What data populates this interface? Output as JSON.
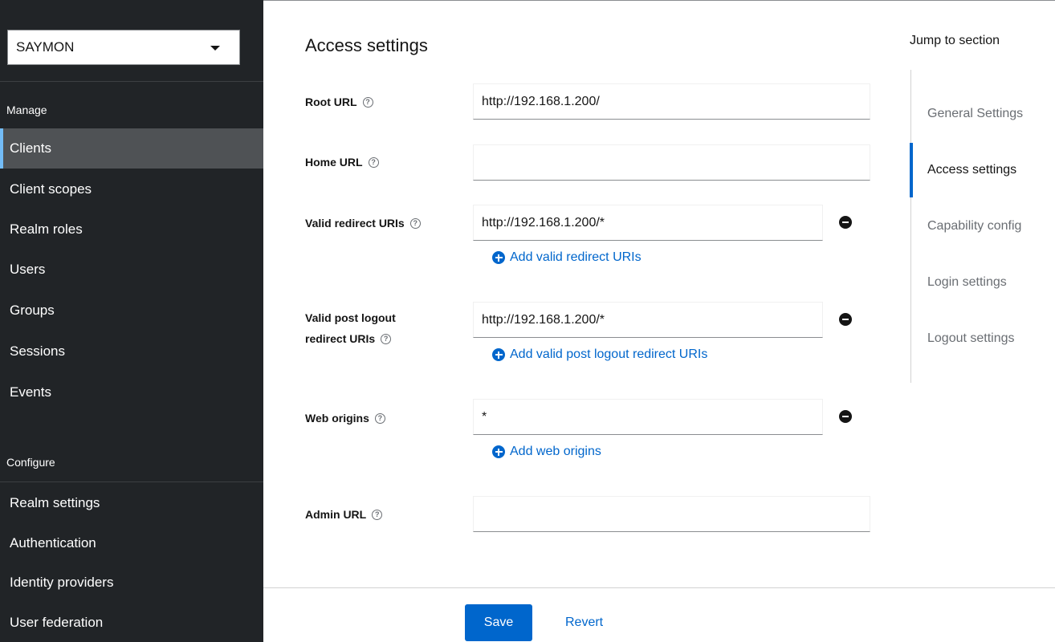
{
  "sidebar": {
    "realm": "SAYMON",
    "manage_heading": "Manage",
    "manage_items": [
      {
        "label": "Clients",
        "active": true
      },
      {
        "label": "Client scopes",
        "active": false
      },
      {
        "label": "Realm roles",
        "active": false
      },
      {
        "label": "Users",
        "active": false
      },
      {
        "label": "Groups",
        "active": false
      },
      {
        "label": "Sessions",
        "active": false
      },
      {
        "label": "Events",
        "active": false
      }
    ],
    "configure_heading": "Configure",
    "configure_items": [
      {
        "label": "Realm settings"
      },
      {
        "label": "Authentication"
      },
      {
        "label": "Identity providers"
      },
      {
        "label": "User federation"
      }
    ]
  },
  "main": {
    "section_title": "Access settings",
    "help_glyph": "?",
    "root_url": {
      "label": "Root URL",
      "value": "http://192.168.1.200/"
    },
    "home_url": {
      "label": "Home URL",
      "value": ""
    },
    "valid_redirect": {
      "label": "Valid redirect URIs",
      "value": "http://192.168.1.200/*",
      "add_label": "Add valid redirect URIs"
    },
    "post_logout": {
      "label_line1": "Valid post logout",
      "label_line2": "redirect URIs",
      "value": "http://192.168.1.200/*",
      "add_label": "Add valid post logout redirect URIs"
    },
    "web_origins": {
      "label": "Web origins",
      "value": "*",
      "add_label": "Add web origins"
    },
    "admin_url": {
      "label": "Admin URL",
      "value": ""
    },
    "save_label": "Save",
    "revert_label": "Revert"
  },
  "jump": {
    "title": "Jump to section",
    "items": [
      {
        "label": "General Settings",
        "active": false
      },
      {
        "label": "Access settings",
        "active": true
      },
      {
        "label": "Capability config",
        "active": false
      },
      {
        "label": "Login settings",
        "active": false
      },
      {
        "label": "Logout settings",
        "active": false
      }
    ]
  },
  "colors": {
    "sidebar_bg": "#212427",
    "sidebar_active": "#4f5255",
    "accent": "#0066cc",
    "active_indicator": "#73bcf7"
  }
}
